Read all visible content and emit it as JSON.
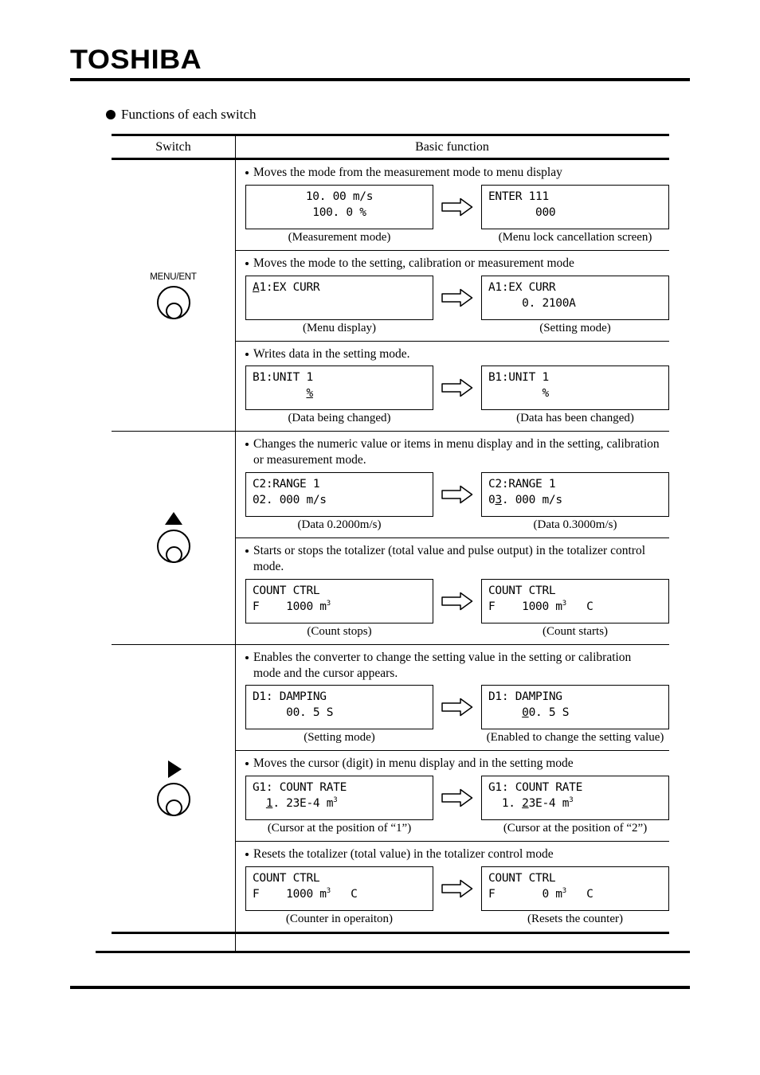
{
  "brand": "TOSHIBA",
  "section_heading": "Functions of each switch",
  "table": {
    "headers": {
      "switch": "Switch",
      "basic_function": "Basic function"
    },
    "groups": [
      {
        "switch": {
          "label": "MENU/ENT",
          "icon": "round-knob-icon",
          "marker": "none"
        },
        "blocks": [
          {
            "description": "Moves the mode from the measurement mode to menu display",
            "left": {
              "align": "center",
              "lines": [
                [
                  {
                    "t": "10. 00 m/s"
                  }
                ],
                [
                  {
                    "t": "100. 0 %"
                  }
                ]
              ],
              "caption": "(Measurement mode)"
            },
            "right": {
              "align": "left",
              "lines": [
                [
                  {
                    "t": "ENTER 111"
                  }
                ],
                [
                  {
                    "t": "       000"
                  }
                ]
              ],
              "caption": "(Menu lock cancellation screen)"
            }
          },
          {
            "description": "Moves the mode to the setting, calibration or measurement mode",
            "left": {
              "align": "left",
              "lines": [
                [
                  {
                    "t": "A",
                    "u": true
                  },
                  {
                    "t": "1:EX CURR"
                  }
                ],
                [
                  {
                    "t": ""
                  }
                ]
              ],
              "caption": "(Menu display)"
            },
            "right": {
              "align": "left",
              "lines": [
                [
                  {
                    "t": "A1:EX CURR"
                  }
                ],
                [
                  {
                    "t": "     0. 2100A"
                  }
                ]
              ],
              "caption": "(Setting mode)"
            }
          },
          {
            "description": "Writes data in the setting mode.",
            "left": {
              "align": "left",
              "lines": [
                [
                  {
                    "t": "B1:UNIT 1"
                  }
                ],
                [
                  {
                    "t": "        "
                  },
                  {
                    "t": "%",
                    "u": true
                  }
                ]
              ],
              "caption": "(Data being changed)"
            },
            "right": {
              "align": "left",
              "lines": [
                [
                  {
                    "t": "B1:UNIT 1"
                  }
                ],
                [
                  {
                    "t": "        %"
                  }
                ]
              ],
              "caption": "(Data has been changed)"
            }
          }
        ]
      },
      {
        "switch": {
          "label": "",
          "icon": "triangle-up-knob-icon",
          "marker": "up"
        },
        "blocks": [
          {
            "description": "Changes the numeric value or items in menu display and in the setting, calibration or measurement mode.",
            "left": {
              "align": "left",
              "lines": [
                [
                  {
                    "t": "C2:RANGE 1"
                  }
                ],
                [
                  {
                    "t": "02. 000 m/s"
                  }
                ]
              ],
              "caption": "(Data 0.2000m/s)"
            },
            "right": {
              "align": "left",
              "lines": [
                [
                  {
                    "t": "C2:RANGE 1"
                  }
                ],
                [
                  {
                    "t": "0"
                  },
                  {
                    "t": "3",
                    "u": true
                  },
                  {
                    "t": ". 000 m/s"
                  }
                ]
              ],
              "caption": "(Data 0.3000m/s)"
            }
          },
          {
            "description": "Starts or stops the totalizer (total value and pulse output) in the totalizer control mode.",
            "left": {
              "align": "left",
              "lines": [
                [
                  {
                    "t": "COUNT CTRL"
                  }
                ],
                [
                  {
                    "t": "F    1000 m"
                  },
                  {
                    "t": "3",
                    "sup": true
                  }
                ]
              ],
              "caption": "(Count stops)"
            },
            "right": {
              "align": "left",
              "lines": [
                [
                  {
                    "t": "COUNT CTRL"
                  }
                ],
                [
                  {
                    "t": "F    1000 m"
                  },
                  {
                    "t": "3",
                    "sup": true
                  },
                  {
                    "t": "   C"
                  }
                ]
              ],
              "caption": "(Count starts)"
            }
          }
        ]
      },
      {
        "switch": {
          "label": "",
          "icon": "triangle-right-knob-icon",
          "marker": "right"
        },
        "blocks": [
          {
            "description": "Enables the converter to change the setting value in the setting or calibration mode and the cursor appears.",
            "left": {
              "align": "left",
              "lines": [
                [
                  {
                    "t": "D1: DAMPING"
                  }
                ],
                [
                  {
                    "t": "     00. 5 S"
                  }
                ]
              ],
              "caption": "(Setting mode)"
            },
            "right": {
              "align": "left",
              "lines": [
                [
                  {
                    "t": "D1: DAMPING"
                  }
                ],
                [
                  {
                    "t": "     "
                  },
                  {
                    "t": "0",
                    "u": true
                  },
                  {
                    "t": "0. 5 S"
                  }
                ]
              ],
              "caption": "(Enabled to change the setting value)"
            }
          },
          {
            "description": "Moves the cursor (digit) in menu display and in the setting mode",
            "left": {
              "align": "left",
              "lines": [
                [
                  {
                    "t": "G1: COUNT RATE"
                  }
                ],
                [
                  {
                    "t": "  "
                  },
                  {
                    "t": "1",
                    "u": true
                  },
                  {
                    "t": ". 23E-4 m"
                  },
                  {
                    "t": "3",
                    "sup": true
                  }
                ]
              ],
              "caption": "(Cursor at the position of “1”)"
            },
            "right": {
              "align": "left",
              "lines": [
                [
                  {
                    "t": "G1: COUNT RATE"
                  }
                ],
                [
                  {
                    "t": "  1. "
                  },
                  {
                    "t": "2",
                    "u": true
                  },
                  {
                    "t": "3E-4 m"
                  },
                  {
                    "t": "3",
                    "sup": true
                  }
                ]
              ],
              "caption": "(Cursor at the position of “2”)"
            }
          },
          {
            "description": "Resets the totalizer (total value) in the totalizer control mode",
            "left": {
              "align": "left",
              "lines": [
                [
                  {
                    "t": "COUNT CTRL"
                  }
                ],
                [
                  {
                    "t": "F    1000 m"
                  },
                  {
                    "t": "3",
                    "sup": true
                  },
                  {
                    "t": "   C"
                  }
                ]
              ],
              "caption": "(Counter in operaiton)"
            },
            "right": {
              "align": "left",
              "lines": [
                [
                  {
                    "t": "COUNT CTRL"
                  }
                ],
                [
                  {
                    "t": "F       0 m"
                  },
                  {
                    "t": "3",
                    "sup": true
                  },
                  {
                    "t": "   C"
                  }
                ]
              ],
              "caption": "(Resets the counter)"
            }
          }
        ]
      }
    ]
  }
}
